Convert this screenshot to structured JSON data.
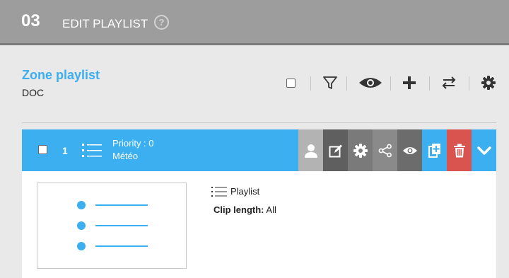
{
  "header": {
    "step": "03",
    "title": "EDIT PLAYLIST",
    "help_icon": "question-circle-icon"
  },
  "zone": {
    "title": "Zone playlist",
    "subtitle": "DOC"
  },
  "toolbar": {
    "icons": [
      "filter-icon",
      "eye-icon",
      "plus-icon",
      "swap-icon",
      "gear-icon"
    ]
  },
  "row": {
    "number": "1",
    "priority": "Priority : 0",
    "name": "Météo",
    "actions": [
      "user-icon",
      "edit-icon",
      "gear-icon",
      "share-icon",
      "eye-icon",
      "copy-icon",
      "trash-icon",
      "chevron-down-icon"
    ]
  },
  "details": {
    "type_label": "Playlist",
    "clip_length_label": "Clip length:",
    "clip_length_value": "All"
  },
  "colors": {
    "accent": "#3baff0",
    "delete": "#d9534f",
    "header": "#9d9d9d"
  }
}
